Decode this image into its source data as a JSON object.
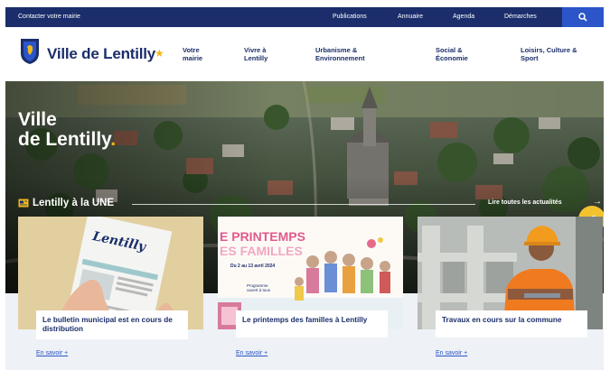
{
  "topbar": {
    "contact": "Contacter votre mairie",
    "links": [
      "Publications",
      "Annuaire",
      "Agenda",
      "Démarches"
    ],
    "search_icon": "search-icon"
  },
  "header": {
    "site_name": "Ville de Lentilly",
    "nav": [
      {
        "line1": "Votre",
        "line2": "mairie"
      },
      {
        "line1": "Vivre à",
        "line2": "Lentilly"
      },
      {
        "line1": "Urbanisme &",
        "line2": "Environnement"
      },
      {
        "line1": "Social &",
        "line2": "Économie"
      },
      {
        "line1": "Loisirs, Culture &",
        "line2": "Sport"
      }
    ]
  },
  "hero": {
    "title_line1": "Ville",
    "title_line2": "de Lentilly",
    "title_dot": ".",
    "une_title": "Lentilly à la UNE",
    "all_news": "Lire toutes les actualités"
  },
  "cards": [
    {
      "title": "Le bulletin municipal est en cours de distribution",
      "more": "En savoir +",
      "image_text": "Lentilly"
    },
    {
      "title": "Le printemps des familles à Lentilly",
      "more": "En savoir +",
      "image_line1": "E PRINTEMPS",
      "image_line2": "ES FAMILLES",
      "image_dates": "Du 2 au 13 avril 2024",
      "image_prog": "Programme ouvert à tous"
    },
    {
      "title": "Travaux en cours sur la commune",
      "more": "En savoir +"
    }
  ],
  "colors": {
    "navy": "#1b2e6b",
    "blue": "#2b55c9",
    "yellow": "#f3b71a"
  }
}
